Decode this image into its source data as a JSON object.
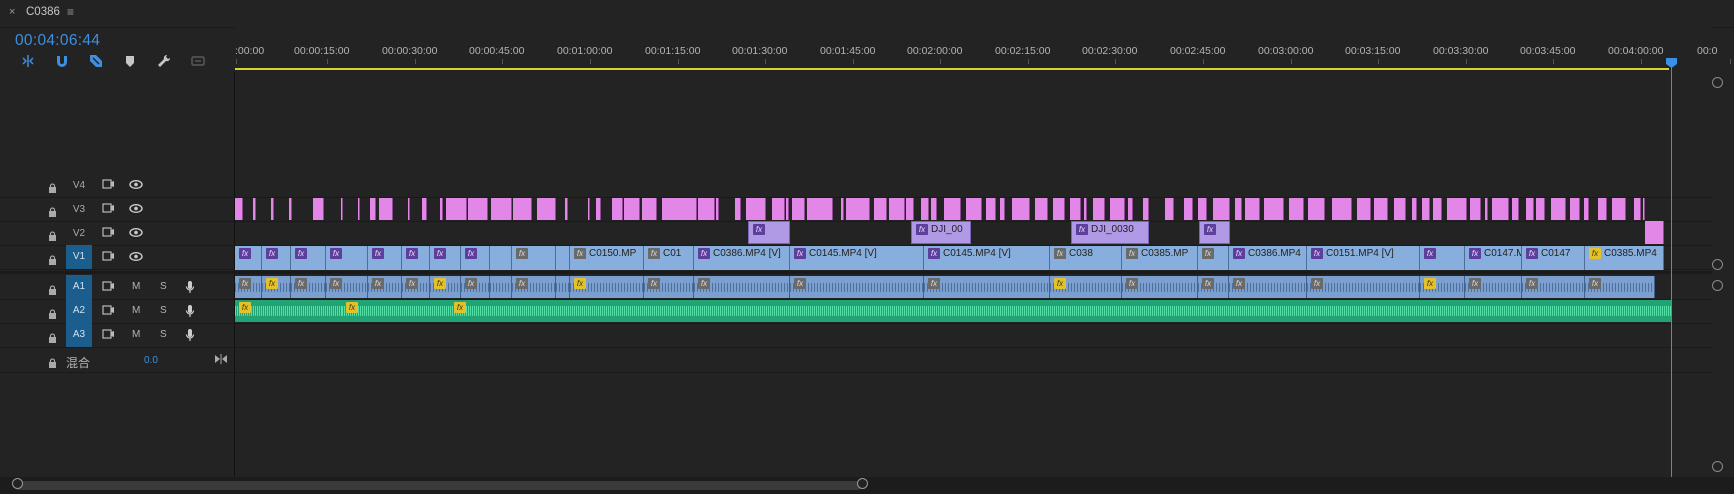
{
  "sequence_tab": {
    "close_glyph": "×",
    "title": "C0386",
    "menu_glyph": "≡"
  },
  "timecode": "00:04:06:44",
  "tools": [
    "ripple-icon",
    "snap-magnet-icon",
    "linked-selection-icon",
    "marker-icon",
    "wrench-icon",
    "caption-icon"
  ],
  "ruler_labels": [
    ":00:00",
    "00:00:15:00",
    "00:00:30:00",
    "00:00:45:00",
    "00:01:00:00",
    "00:01:15:00",
    "00:01:30:00",
    "00:01:45:00",
    "00:02:00:00",
    "00:02:15:00",
    "00:02:30:00",
    "00:02:45:00",
    "00:03:00:00",
    "00:03:15:00",
    "00:03:30:00",
    "00:03:45:00",
    "00:04:00:00",
    "00:0"
  ],
  "video_tracks": [
    {
      "name": "V4"
    },
    {
      "name": "V3"
    },
    {
      "name": "V2"
    },
    {
      "name": "V1"
    }
  ],
  "audio_tracks": [
    {
      "name": "A1",
      "m": "M",
      "s": "S"
    },
    {
      "name": "A2",
      "m": "M",
      "s": "S"
    },
    {
      "name": "A3",
      "m": "M",
      "s": "S"
    }
  ],
  "mix_track": {
    "name": "混合",
    "value": "0.0"
  },
  "fx_glyph": "fx",
  "v2_clip_labels": [
    "DJI_00",
    "DJI_0030"
  ],
  "v1_clip_labels": [
    "C0150.MP",
    "C01",
    "C0386.MP4 [V]",
    "C0145.MP4 [V]",
    "C0145.MP4 [V]",
    "C038",
    "C0385.MP",
    "C0386.MP4",
    "C0151.MP4 [V]",
    "C0147.MP4",
    "C0147",
    "C0385.MP4"
  ],
  "colors": {
    "timecode": "#3e8fe0",
    "v3_clips": "#e286e8",
    "v2_clips": "#b09ae6",
    "v1_clips": "#87aedd",
    "a2_waveform": "#21a374",
    "playhead": "#3a8fe8",
    "work_area": "#d8d22a",
    "target_track": "#1b5d8c"
  }
}
